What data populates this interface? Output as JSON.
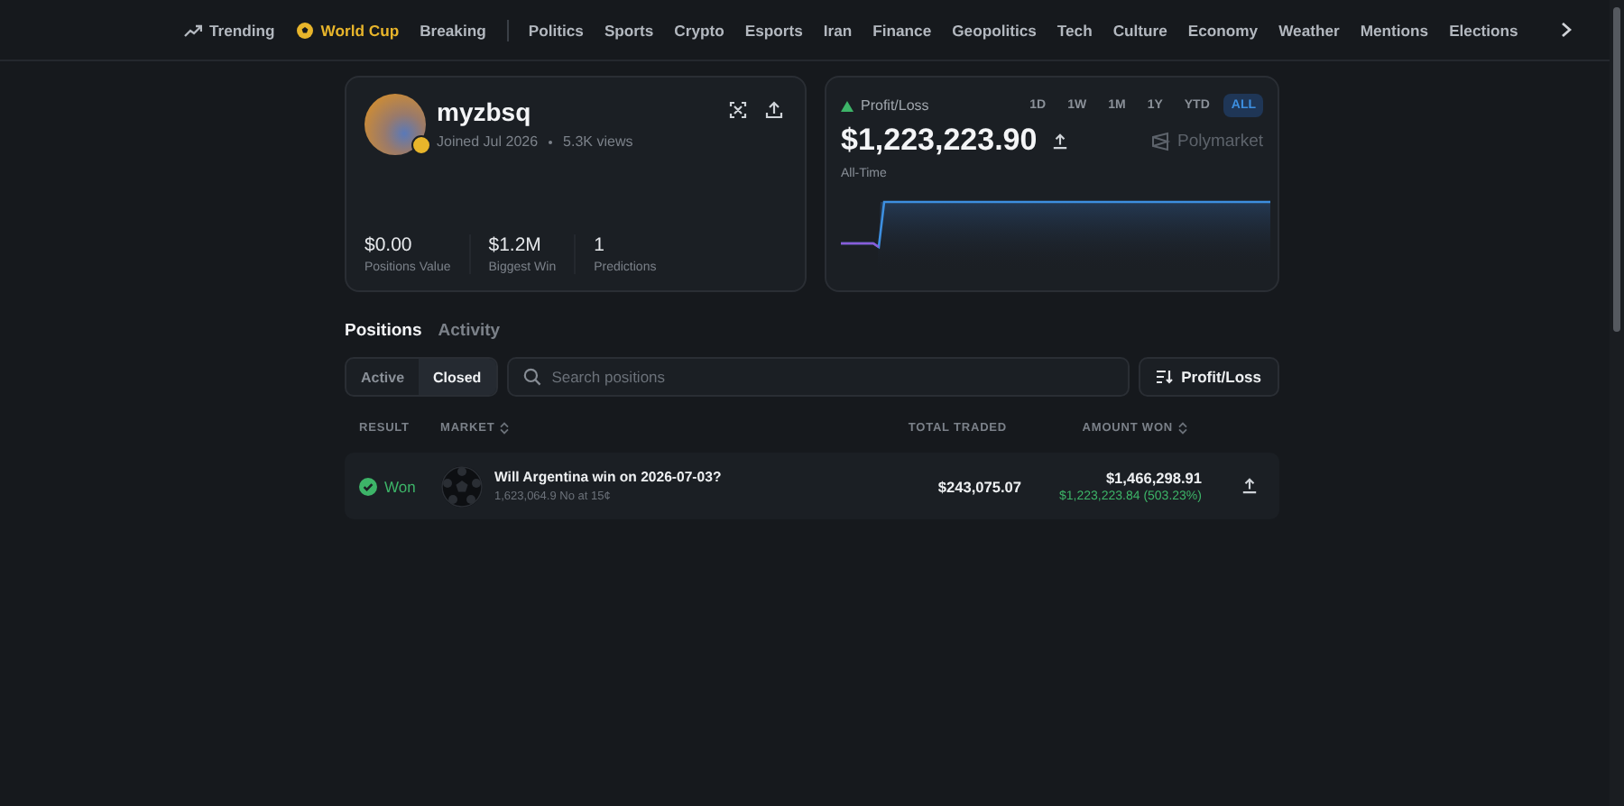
{
  "nav": {
    "items": [
      {
        "label": "Trending",
        "kind": "trending",
        "selected": false
      },
      {
        "label": "World Cup",
        "kind": "worldcup",
        "selected": true
      },
      {
        "label": "Breaking",
        "kind": "plain",
        "selected": false
      },
      {
        "label": "Politics",
        "kind": "divided",
        "selected": false
      },
      {
        "label": "Sports",
        "kind": "plain",
        "selected": false
      },
      {
        "label": "Crypto",
        "kind": "plain",
        "selected": false
      },
      {
        "label": "Esports",
        "kind": "plain",
        "selected": false
      },
      {
        "label": "Iran",
        "kind": "plain",
        "selected": false
      },
      {
        "label": "Finance",
        "kind": "plain",
        "selected": false
      },
      {
        "label": "Geopolitics",
        "kind": "plain",
        "selected": false
      },
      {
        "label": "Tech",
        "kind": "plain",
        "selected": false
      },
      {
        "label": "Culture",
        "kind": "plain",
        "selected": false
      },
      {
        "label": "Economy",
        "kind": "plain",
        "selected": false
      },
      {
        "label": "Weather",
        "kind": "plain",
        "selected": false
      },
      {
        "label": "Mentions",
        "kind": "plain",
        "selected": false
      },
      {
        "label": "Elections",
        "kind": "plain",
        "selected": false
      }
    ]
  },
  "profile": {
    "username": "myzbsq",
    "joined": "Joined Jul 2026",
    "views": "5.3K views",
    "stats": [
      {
        "value": "$0.00",
        "label": "Positions Value"
      },
      {
        "value": "$1.2M",
        "label": "Biggest Win"
      },
      {
        "value": "1",
        "label": "Predictions"
      }
    ]
  },
  "pnl": {
    "title": "Profit/Loss",
    "amount": "$1,223,223.90",
    "period_label": "All-Time",
    "brand": "Polymarket",
    "ranges": [
      {
        "label": "1D",
        "selected": false
      },
      {
        "label": "1W",
        "selected": false
      },
      {
        "label": "1M",
        "selected": false
      },
      {
        "label": "1Y",
        "selected": false
      },
      {
        "label": "YTD",
        "selected": false
      },
      {
        "label": "ALL",
        "selected": true
      }
    ]
  },
  "tabs": [
    {
      "label": "Positions",
      "selected": true
    },
    {
      "label": "Activity",
      "selected": false
    }
  ],
  "filter": [
    {
      "label": "Active",
      "selected": false
    },
    {
      "label": "Closed",
      "selected": true
    }
  ],
  "search": {
    "placeholder": "Search positions"
  },
  "sort_button": "Profit/Loss",
  "table": {
    "columns": [
      {
        "label": "RESULT",
        "sortable": false
      },
      {
        "label": "MARKET",
        "sortable": true
      },
      {
        "label": "TOTAL TRADED",
        "sortable": false
      },
      {
        "label": "AMOUNT WON",
        "sortable": true
      }
    ],
    "rows": [
      {
        "result": "Won",
        "won": true,
        "title": "Will Argentina win on 2026-07-03?",
        "detail": "1,623,064.9 No at 15¢",
        "traded": "$243,075.07",
        "amount": "$1,466,298.91",
        "gain": "$1,223,223.84 (503.23%)"
      }
    ]
  }
}
